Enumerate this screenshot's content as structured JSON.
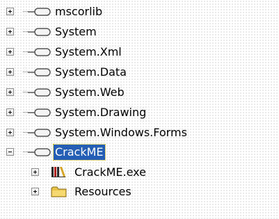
{
  "tree": {
    "references": [
      {
        "label": "mscorlib",
        "expander": "plus",
        "selected": false
      },
      {
        "label": "System",
        "expander": "plus",
        "selected": false
      },
      {
        "label": "System.Xml",
        "expander": "plus",
        "selected": false
      },
      {
        "label": "System.Data",
        "expander": "plus",
        "selected": false
      },
      {
        "label": "System.Web",
        "expander": "plus",
        "selected": false
      },
      {
        "label": "System.Drawing",
        "expander": "plus",
        "selected": false
      },
      {
        "label": "System.Windows.Forms",
        "expander": "plus",
        "selected": false
      },
      {
        "label": "CrackME",
        "expander": "minus",
        "selected": true
      }
    ],
    "crackme_children": [
      {
        "label": "CrackME.exe",
        "icon": "assembly-icon"
      },
      {
        "label": "Resources",
        "icon": "folder-icon"
      }
    ]
  },
  "colors": {
    "selection": "#245eb5",
    "selection_text": "#ffffff"
  }
}
